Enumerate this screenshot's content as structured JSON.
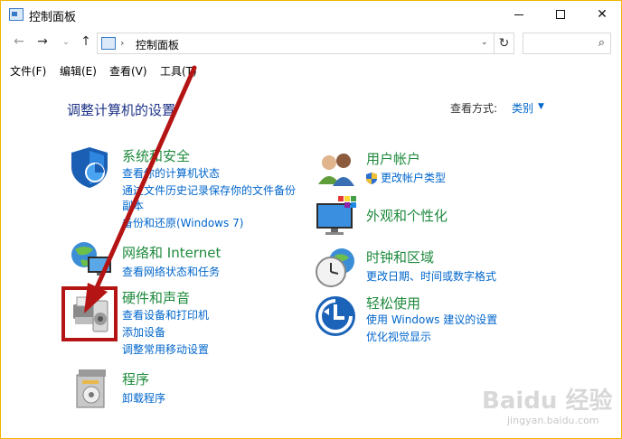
{
  "window": {
    "title": "控制面板"
  },
  "nav": {
    "back": "←",
    "forward": "→",
    "recent": "⌄",
    "up": "↑",
    "address_separator": "›",
    "address": "控制面板",
    "dropdown": "⌄",
    "refresh": "↻",
    "search_placeholder": "",
    "search_icon": "⌕"
  },
  "menu": [
    "文件(F)",
    "编辑(E)",
    "查看(V)",
    "工具(T)"
  ],
  "content": {
    "title": "调整计算机的设置",
    "view_by_label": "查看方式:",
    "view_by_value": "类别"
  },
  "categories": [
    {
      "id": "system-security",
      "title": "系统和安全",
      "links": [
        "查看你的计算机状态",
        "通过文件历史记录保存你的文件备份",
        "副本",
        "备份和还原(Windows 7)"
      ],
      "icon": "shield-icon"
    },
    {
      "id": "network",
      "title": "网络和 Internet",
      "links": [
        "查看网络状态和任务"
      ],
      "icon": "network-icon"
    },
    {
      "id": "hardware-sound",
      "title": "硬件和声音",
      "links": [
        "查看设备和打印机",
        "添加设备",
        "调整常用移动设置"
      ],
      "icon": "printer-icon"
    },
    {
      "id": "programs",
      "title": "程序",
      "links": [
        "卸载程序"
      ],
      "icon": "programs-icon"
    },
    {
      "id": "user-accounts",
      "title": "用户帐户",
      "links": [
        "更改帐户类型"
      ],
      "icon": "users-icon"
    },
    {
      "id": "appearance",
      "title": "外观和个性化",
      "links": [],
      "icon": "appearance-icon"
    },
    {
      "id": "clock-region",
      "title": "时钟和区域",
      "links": [
        "更改日期、时间或数字格式"
      ],
      "icon": "clock-icon"
    },
    {
      "id": "ease-of-access",
      "title": "轻松使用",
      "links": [
        "使用 Windows 建议的设置",
        "优化视觉显示"
      ],
      "icon": "accessibility-icon"
    }
  ],
  "watermark": {
    "brand": "Baidu 经验",
    "url": "jingyan.baidu.com"
  },
  "colors": {
    "window_border": "#f0b400",
    "category_title": "#1e8a3c",
    "link": "#0066cc",
    "heading": "#1e3287",
    "annotation_red": "#b41414"
  }
}
